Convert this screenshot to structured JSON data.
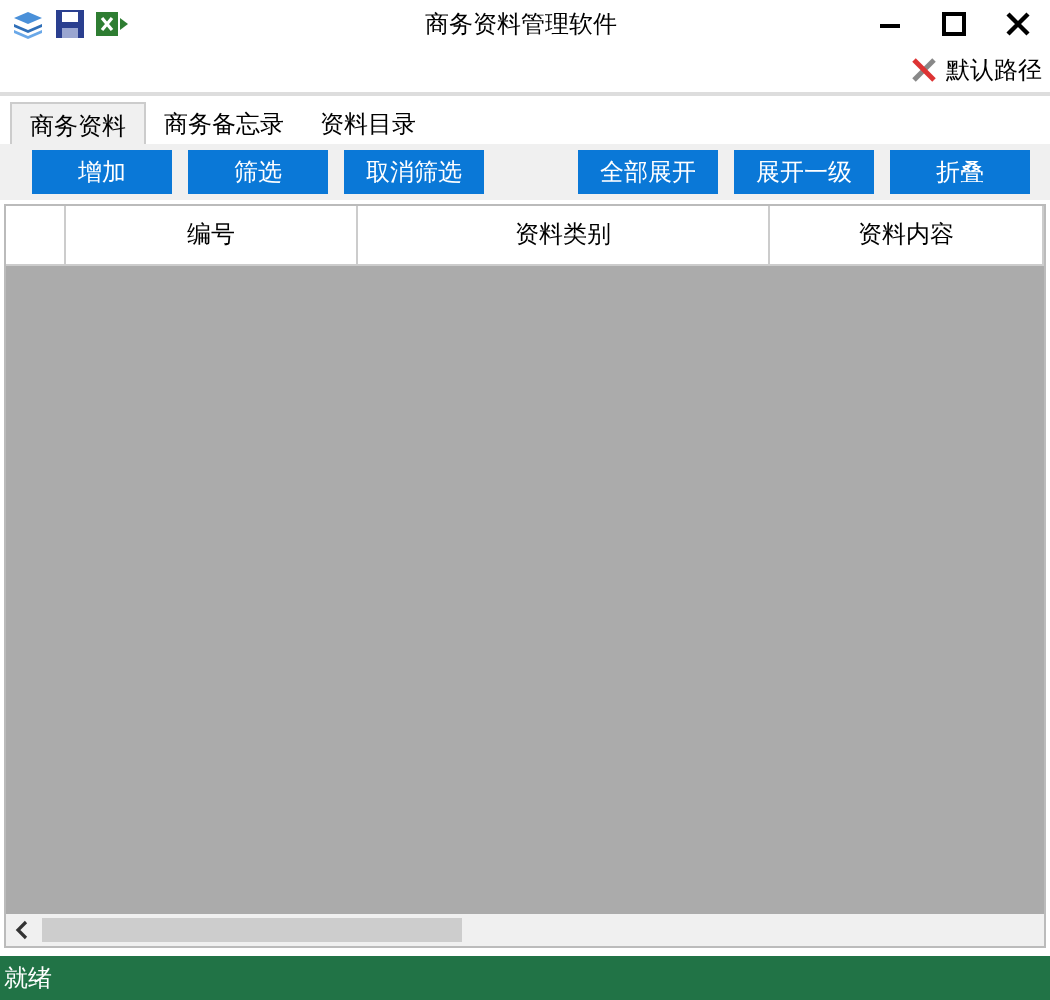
{
  "window": {
    "title": "商务资料管理软件"
  },
  "path_button": {
    "label": "默认路径"
  },
  "tabs": [
    {
      "label": "商务资料",
      "selected": true
    },
    {
      "label": "商务备忘录",
      "selected": false
    },
    {
      "label": "资料目录",
      "selected": false
    }
  ],
  "toolbar_left": [
    "增加",
    "筛选",
    "取消筛选"
  ],
  "toolbar_right": [
    "全部展开",
    "展开一级",
    "折叠"
  ],
  "table": {
    "columns": [
      "编号",
      "资料类别",
      "资料内容"
    ]
  },
  "status_bar": {
    "text": "就绪"
  }
}
